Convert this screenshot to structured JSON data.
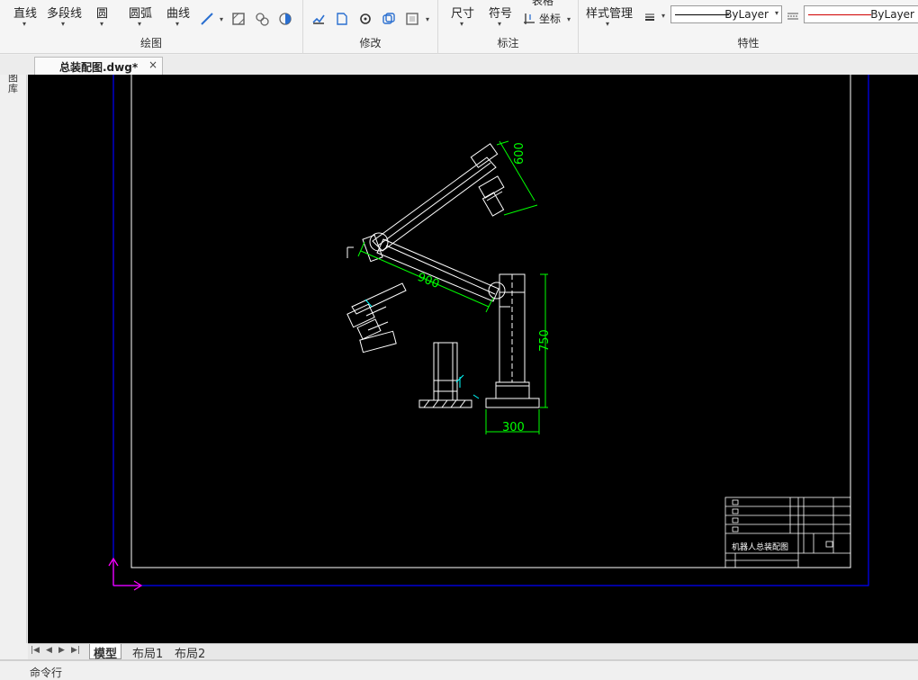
{
  "ribbon": {
    "draw": {
      "title": "绘图",
      "line": "直线",
      "polyline": "多段线",
      "circle": "圆",
      "arc": "圆弧",
      "curve": "曲线"
    },
    "modify": {
      "title": "修改"
    },
    "annotate": {
      "title": "标注",
      "dimension": "尺寸",
      "symbol": "符号",
      "table": "表格",
      "coordinate": "坐标"
    },
    "properties": {
      "title": "特性",
      "style_manager": "样式管理",
      "linetype_value": "ByLayer",
      "color_value": "ByLayer",
      "linetype_color": "#000000",
      "color_line_color": "#d00000"
    }
  },
  "document_tab": {
    "title": "总装配图.dwg*",
    "close": "×"
  },
  "sidebar": {
    "label": "图库"
  },
  "drawing": {
    "dim_upper_arm": "600",
    "dim_lower_arm": "900",
    "dim_column_height": "750",
    "dim_base_width": "300",
    "title_block_name": "机器人总装配图",
    "colors": {
      "background": "#000000",
      "geometry": "#ffffff",
      "dimension": "#00ff00",
      "paper_border": "#0000ff",
      "ucs": "#ff00ff",
      "center": "#00ffff"
    }
  },
  "layout_tabs": {
    "model": "模型",
    "layout1": "布局1",
    "layout2": "布局2"
  },
  "command_line": {
    "label": "命令行"
  }
}
